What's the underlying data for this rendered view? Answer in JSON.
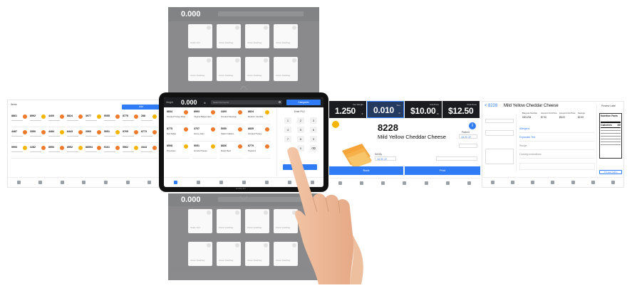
{
  "strip_top": {
    "header_value": "0.000",
    "tile_labels": [
      "Scale Unit",
      "Action Hashtag",
      "Action Hashtag",
      "Action Hashtag",
      "Action Hashtag",
      "Action Hashtag",
      "Action Hashtag",
      "Action Hashtag"
    ]
  },
  "strip_bottom": {
    "header_value": "0.000",
    "tile_labels": [
      "Scale Unit",
      "Action Hashtag",
      "Action Hashtag",
      "Action Hashtag",
      "Action Hashtag",
      "Action Hashtag",
      "Action Hashtag",
      "Action Hashtag"
    ]
  },
  "tablet": {
    "weight_label": "Weight",
    "weight_value": "0.000",
    "weight_unit": "lb",
    "search_placeholder": "Search for items",
    "action_button": "Categories",
    "bezel_label": "HOBART",
    "tiles": [
      {
        "code": "8834",
        "name": "Smoked Turkey Breast",
        "color": "o"
      },
      {
        "code": "8993",
        "name": "Virginia Baked Ham",
        "color": "o"
      },
      {
        "code": "4400",
        "name": "Smoked Sausage",
        "color": "o"
      },
      {
        "code": "8824",
        "name": "Medium Cheddar",
        "color": "y"
      },
      {
        "code": "8775",
        "name": "Deli Salad",
        "color": "o"
      },
      {
        "code": "3707",
        "name": "Honey Ham",
        "color": "o"
      },
      {
        "code": "5050",
        "name": "Salami Italiano",
        "color": "o"
      },
      {
        "code": "8835",
        "name": "Smoked Turkey",
        "color": "o"
      },
      {
        "code": "8508",
        "name": "Provolone",
        "color": "y"
      },
      {
        "code": "5051",
        "name": "Gouda Cheese",
        "color": "y"
      },
      {
        "code": "8836",
        "name": "Roast Beef",
        "color": "o"
      },
      {
        "code": "8779",
        "name": "Pastrami",
        "color": "o"
      }
    ],
    "keypad_title": "Enter PLU",
    "keys": [
      "1",
      "2",
      "3",
      "4",
      "5",
      "6",
      "7",
      "8",
      "9",
      "0",
      "⌫"
    ]
  },
  "left_panel": {
    "title": "Items",
    "button": "Add",
    "codes": [
      "8861",
      "8992",
      "4400",
      "8824",
      "3977",
      "5055",
      "8775",
      "288",
      "4487",
      "3350",
      "4484",
      "8443",
      "2960",
      "5051",
      "9765",
      "8773",
      "9993",
      "2282",
      "8553",
      "8552",
      "88594",
      "5161",
      "5562",
      "3444"
    ],
    "nav": [
      "Home",
      "Items",
      "Labels",
      "Reports",
      "Alerts",
      "Settings",
      "More"
    ]
  },
  "detail": {
    "stats": [
      {
        "caption": "Net Weight",
        "value": "1.250",
        "unit": "lb"
      },
      {
        "caption": "Tare",
        "value": "0.010",
        "unit": "lb"
      },
      {
        "caption": "Unit Price",
        "value": "$10.00",
        "unit": "/lb"
      },
      {
        "caption": "Total Price",
        "value": "$12.50",
        "unit": ""
      }
    ],
    "plu": "8228",
    "name": "Mild Yellow Cheddar Cheese",
    "sell_by_label": "Sell By",
    "sell_by_value": "Jul 30, 22",
    "pack_label": "Packed",
    "pack_value": "Jul 20, 22",
    "back_button": "Back",
    "print_button": "Print"
  },
  "edit_panel": {
    "back_label": "<",
    "plu": "8228",
    "title": "Mild Yellow Cheddar Cheese",
    "columns": [
      "Barcode Number",
      "Amount Unit Price",
      "Amount Unit Price",
      "Savings"
    ],
    "values": [
      "0001234",
      "$7.00",
      "$5.00",
      "$2.00"
    ],
    "sections": [
      "Allergens",
      "Expanded Text",
      "Recipe",
      "Cooking Instructions"
    ],
    "preview_label": "Preview Label",
    "nutrition_title": "Nutrition Facts",
    "calories_label": "Calories",
    "calories_value": "80",
    "preview_button": "Preview Label"
  },
  "colors": {
    "accent": "#2f7cf6",
    "orange": "#f07a2c",
    "yellow": "#f4b400",
    "dark": "#1b1c1f"
  }
}
